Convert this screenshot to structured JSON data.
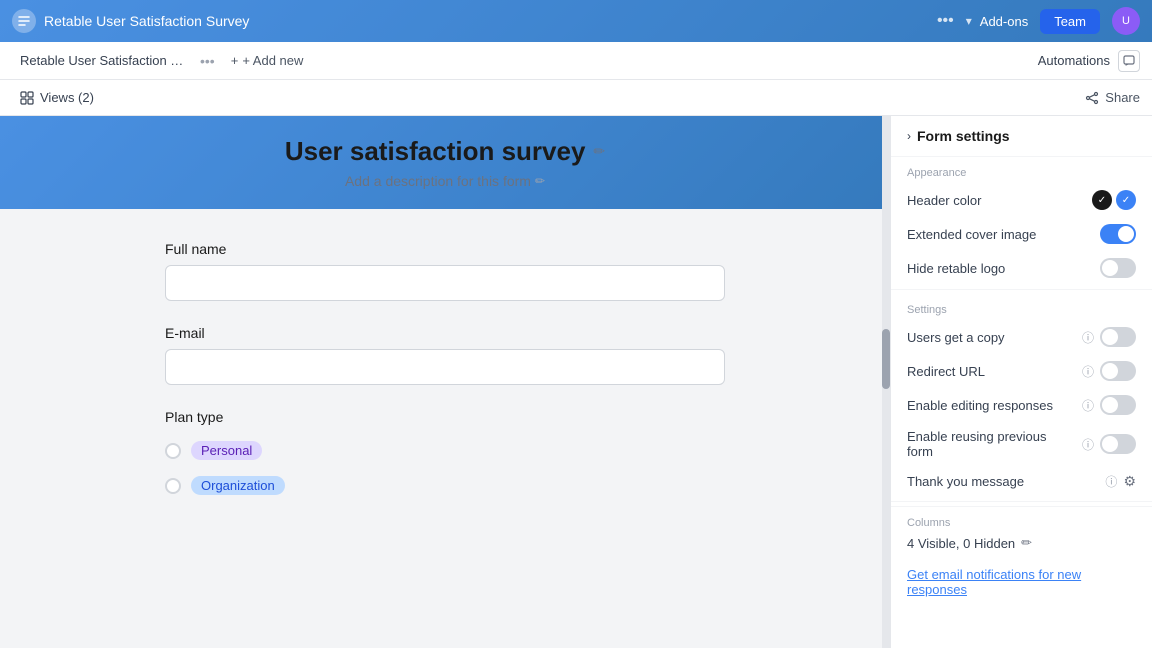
{
  "topNav": {
    "title": "Retable User Satisfaction Survey",
    "addons_label": "Add-ons",
    "team_label": "Team",
    "dots": "•••",
    "chevron": "▾"
  },
  "subNav": {
    "tab_label": "Retable User Satisfaction S...",
    "add_new_label": "+ Add new",
    "automations_label": "Automations",
    "share_label": "Share"
  },
  "viewsBar": {
    "views_label": "Views (2)",
    "share_label": "Share"
  },
  "formSettings": {
    "section_title": "Form settings",
    "appearance_label": "Appearance",
    "header_color_label": "Header color",
    "extended_cover_label": "Extended cover image",
    "hide_logo_label": "Hide retable logo",
    "settings_label": "Settings",
    "users_copy_label": "Users get a copy",
    "redirect_url_label": "Redirect URL",
    "enable_editing_label": "Enable editing responses",
    "enable_reusing_label": "Enable reusing previous form",
    "thank_you_label": "Thank you message",
    "columns_label": "Columns",
    "columns_visible": "4 Visible, 0 Hidden",
    "email_notification_label": "Get email notifications for new responses"
  },
  "form": {
    "title": "User satisfaction survey",
    "description": "Add a description for this form",
    "fullname_label": "Full name",
    "email_label": "E-mail",
    "plantype_label": "Plan type",
    "plantype_options": [
      {
        "id": "personal",
        "label": "Personal",
        "badge_class": "personal"
      },
      {
        "id": "organization",
        "label": "Organization",
        "badge_class": "organization"
      }
    ]
  },
  "toggles": {
    "header_color_dark": true,
    "header_color_blue": true,
    "extended_cover": true,
    "hide_logo": false,
    "users_copy": false,
    "redirect_url": false,
    "enable_editing": false,
    "enable_reusing": false
  }
}
